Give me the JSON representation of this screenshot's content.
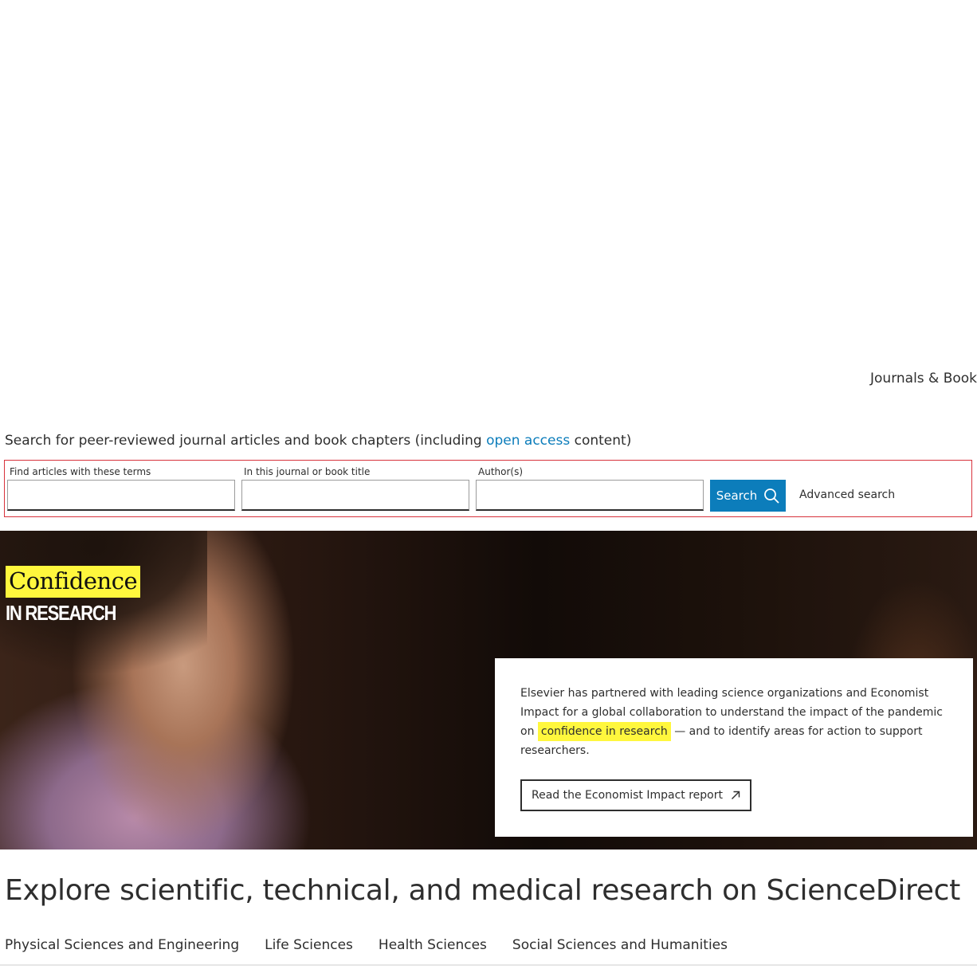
{
  "top_nav": {
    "journals_books": "Journals & Books"
  },
  "search": {
    "intro_prefix": "Search for peer-reviewed journal articles and book chapters (including ",
    "intro_link": "open access",
    "intro_suffix": " content)",
    "fields": [
      {
        "label": "Find articles with these terms",
        "value": ""
      },
      {
        "label": "In this journal or book title",
        "value": ""
      },
      {
        "label": "Author(s)",
        "value": ""
      }
    ],
    "search_button": "Search",
    "advanced_search": "Advanced search"
  },
  "hero": {
    "logo_line1": "Confidence",
    "logo_line2": "IN RESEARCH",
    "card_text_1": "Elsevier has partnered with leading science organizations and Economist Impact for a global collaboration to understand the impact of the pandemic on ",
    "card_highlight": "confidence in research",
    "card_text_2": " — and to identify areas for action to support researchers.",
    "cta_label": "Read the Economist Impact report"
  },
  "explore": {
    "title": "Explore scientific, technical, and medical research on ScienceDirect",
    "tabs": [
      "Physical Sciences and Engineering",
      "Life Sciences",
      "Health Sciences",
      "Social Sciences and Humanities"
    ]
  },
  "colors": {
    "link_blue": "#0c7dbb",
    "highlight_yellow": "#fff73d",
    "form_border_red": "#d8323c"
  }
}
